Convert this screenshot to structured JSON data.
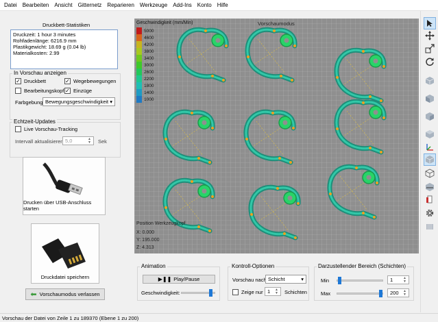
{
  "menu": [
    "Datei",
    "Bearbeiten",
    "Ansicht",
    "Gitternetz",
    "Reparieren",
    "Werkzeuge",
    "Add-Ins",
    "Konto",
    "Hilfe"
  ],
  "stats": {
    "title": "Druckbett-Statistiken",
    "lines": [
      "Druckzeit: 1 hour 3 minutes",
      "Rohfadenlänge: 6216.9 mm",
      "Plastikgewicht: 18.69 g (0.04 lb)",
      "Materialkosten: 2.99"
    ]
  },
  "preview": {
    "title": "In Vorschau anzeigen",
    "checks": [
      {
        "label": "Druckbett",
        "checked": true
      },
      {
        "label": "Wegebewegungen",
        "checked": true
      },
      {
        "label": "Bearbeitungskopf",
        "checked": false
      },
      {
        "label": "Einzüge",
        "checked": true
      }
    ],
    "color_label": "Farbgebung",
    "color_value": "Bewegungsgeschwindigkeit"
  },
  "realtime": {
    "title": "Echtzeit-Updates",
    "live_label": "Live Vorschau-Tracking",
    "interval_label": "Intervall aktualisieren",
    "interval_value": "5,0",
    "interval_unit": "Sek"
  },
  "usb_label": "Drucken über USB-Anschluss starten",
  "save_label": "Druckdatei speichern",
  "exit_label": "Vorschaumodus verlassen",
  "viewport": {
    "legend_title": "Geschwindigkeit (mm/Min)",
    "mode_title": "Vorschaumodus",
    "legend": [
      {
        "value": "5000",
        "color": "#c21a1a"
      },
      {
        "value": "4600",
        "color": "#d8641c"
      },
      {
        "value": "4200",
        "color": "#c8b41e"
      },
      {
        "value": "3800",
        "color": "#a8c81e"
      },
      {
        "value": "3400",
        "color": "#6fc81e"
      },
      {
        "value": "3000",
        "color": "#3fc82a"
      },
      {
        "value": "2600",
        "color": "#22c85a"
      },
      {
        "value": "2200",
        "color": "#1ec890"
      },
      {
        "value": "1800",
        "color": "#1ebfb4"
      },
      {
        "value": "1400",
        "color": "#1e9cc4"
      },
      {
        "value": "1000",
        "color": "#1e7ac4"
      }
    ],
    "position_title": "Position Werkzeugkopf",
    "x": "X: 0.000",
    "y": "Y: 195.000",
    "z": "Z: 4.313"
  },
  "animation": {
    "title": "Animation",
    "play_label": "Play/Pause",
    "speed_label": "Geschwindigkeit:",
    "speed_level": 0.85
  },
  "control": {
    "title": "Kontroll-Optionen",
    "preview_by_label": "Vorschau nach",
    "preview_by_value": "Schicht",
    "show_only_label": "Zeige nur",
    "show_only_value": "1",
    "layers_label": "Schichten"
  },
  "range": {
    "title": "Darzustellender Bereich (Schichten)",
    "min_label": "Min",
    "min_value": "1",
    "max_label": "Max",
    "max_value": "200"
  },
  "toolbar_icons": [
    "cursor-icon",
    "move-icon",
    "scale-icon",
    "rotate-icon",
    "cube-view-icon",
    "cube-front-icon",
    "cube-left-icon",
    "cube-right-icon",
    "axes-icon",
    "cube-iso-icon",
    "cube-wire-icon",
    "cube-section-icon",
    "cube-red-icon",
    "gear-icon",
    "layers-icon"
  ],
  "status": "Vorschau der Datei von Zeile 1 zu 189370 (Ebene 1 zu 200)"
}
